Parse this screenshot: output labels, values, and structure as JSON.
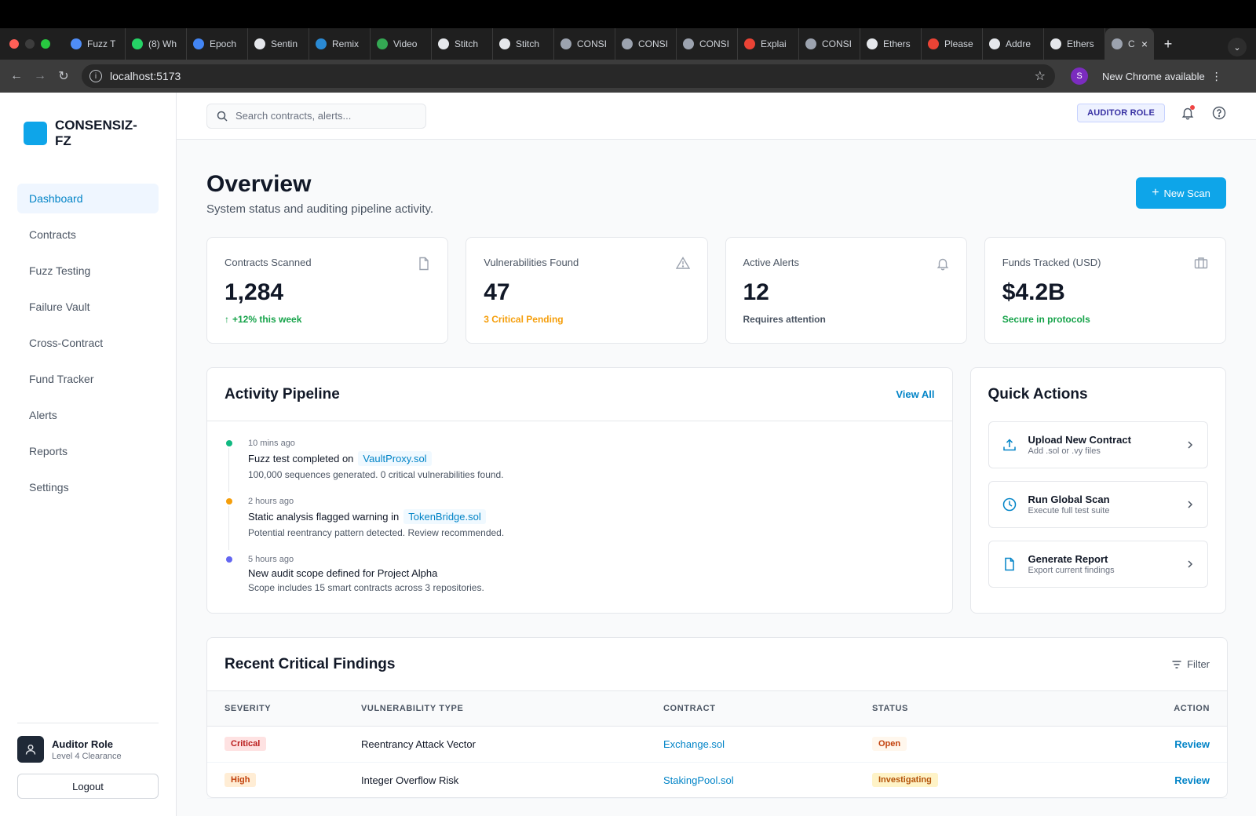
{
  "browser": {
    "tabs": [
      {
        "label": "Fuzz T",
        "icon": "gemini-icon",
        "color": "#4f8df7"
      },
      {
        "label": "(8) Wh",
        "icon": "whatsapp-icon",
        "color": "#25d366"
      },
      {
        "label": "Epoch",
        "icon": "docs-icon",
        "color": "#4285f4"
      },
      {
        "label": "Sentin",
        "icon": "openai-icon",
        "color": "#ffffff"
      },
      {
        "label": "Remix",
        "icon": "remix-icon",
        "color": "#2a8ad4"
      },
      {
        "label": "Video",
        "icon": "video-icon",
        "color": "#34a853"
      },
      {
        "label": "Stitch",
        "icon": "stitch-icon",
        "color": "#ffffff"
      },
      {
        "label": "Stitch",
        "icon": "stitch-icon",
        "color": "#ffffff"
      },
      {
        "label": "CONSI",
        "icon": "globe-icon",
        "color": "#9ca3af"
      },
      {
        "label": "CONSI",
        "icon": "globe-icon",
        "color": "#9ca3af"
      },
      {
        "label": "CONSI",
        "icon": "globe-icon",
        "color": "#9ca3af"
      },
      {
        "label": "Explai",
        "icon": "google-icon",
        "color": "#ea4335"
      },
      {
        "label": "CONSI",
        "icon": "globe-icon",
        "color": "#9ca3af"
      },
      {
        "label": "Ethers",
        "icon": "etherscan-icon",
        "color": "#ffffff"
      },
      {
        "label": "Please",
        "icon": "gmail-icon",
        "color": "#ea4335"
      },
      {
        "label": "Addre",
        "icon": "etherscan-icon",
        "color": "#ffffff"
      },
      {
        "label": "Ethers",
        "icon": "etherscan-icon",
        "color": "#ffffff"
      }
    ],
    "active_tab": "CC",
    "url": "localhost:5173",
    "profile_initial": "S",
    "update_label": "New Chrome available"
  },
  "sidebar": {
    "brand": "CONSENSIZ-FZ",
    "items": [
      {
        "label": "Dashboard",
        "active": true
      },
      {
        "label": "Contracts"
      },
      {
        "label": "Fuzz Testing"
      },
      {
        "label": "Failure Vault"
      },
      {
        "label": "Cross-Contract"
      },
      {
        "label": "Fund Tracker"
      },
      {
        "label": "Alerts"
      },
      {
        "label": "Reports"
      },
      {
        "label": "Settings"
      }
    ],
    "user": {
      "name": "Auditor Role",
      "level": "Level 4 Clearance"
    },
    "logout_label": "Logout"
  },
  "topbar": {
    "search_placeholder": "Search contracts, alerts...",
    "role_badge": "AUDITOR ROLE"
  },
  "header": {
    "title": "Overview",
    "subtitle": "System status and auditing pipeline activity.",
    "new_scan_label": "New Scan"
  },
  "stats": [
    {
      "label": "Contracts Scanned",
      "value": "1,284",
      "note": "+12% this week",
      "note_color": "#16a34a",
      "icon": "file-icon",
      "arrow": true
    },
    {
      "label": "Vulnerabilities Found",
      "value": "47",
      "note": "3 Critical Pending",
      "note_color": "#f59e0b",
      "icon": "warning-icon"
    },
    {
      "label": "Active Alerts",
      "value": "12",
      "note": "Requires attention",
      "note_color": "#4b5563",
      "icon": "bell-icon"
    },
    {
      "label": "Funds Tracked (USD)",
      "value": "$4.2B",
      "note": "Secure in protocols",
      "note_color": "#16a34a",
      "icon": "briefcase-icon"
    }
  ],
  "pipeline": {
    "title": "Activity Pipeline",
    "view_all": "View All",
    "items": [
      {
        "time": "10 mins ago",
        "title": "Fuzz test completed on",
        "chip": "VaultProxy.sol",
        "desc": "100,000 sequences generated. 0 critical vulnerabilities found.",
        "dot": "#10b981"
      },
      {
        "time": "2 hours ago",
        "title": "Static analysis flagged warning in",
        "chip": "TokenBridge.sol",
        "desc": "Potential reentrancy pattern detected. Review recommended.",
        "dot": "#f59e0b"
      },
      {
        "time": "5 hours ago",
        "title": "New audit scope defined for Project Alpha",
        "chip": "",
        "desc": "Scope includes 15 smart contracts across 3 repositories.",
        "dot": "#6366f1"
      }
    ]
  },
  "quick_actions": {
    "title": "Quick Actions",
    "items": [
      {
        "title": "Upload New Contract",
        "sub": "Add .sol or .vy files",
        "icon": "upload-icon"
      },
      {
        "title": "Run Global Scan",
        "sub": "Execute full test suite",
        "icon": "clock-icon"
      },
      {
        "title": "Generate Report",
        "sub": "Export current findings",
        "icon": "document-icon"
      }
    ]
  },
  "findings": {
    "title": "Recent Critical Findings",
    "filter_label": "Filter",
    "columns": [
      "SEVERITY",
      "VULNERABILITY TYPE",
      "CONTRACT",
      "STATUS",
      "ACTION"
    ],
    "rows": [
      {
        "severity": "Critical",
        "sev_bg": "#fee2e2",
        "sev_color": "#b91c1c",
        "type": "Reentrancy Attack Vector",
        "contract": "Exchange.sol",
        "status": "Open",
        "status_bg": "#fff7ed",
        "status_color": "#c2410c",
        "action": "Review"
      },
      {
        "severity": "High",
        "sev_bg": "#ffedd5",
        "sev_color": "#c2410c",
        "type": "Integer Overflow Risk",
        "contract": "StakingPool.sol",
        "status": "Investigating",
        "status_bg": "#fef3c7",
        "status_color": "#b45309",
        "action": "Review"
      }
    ]
  }
}
